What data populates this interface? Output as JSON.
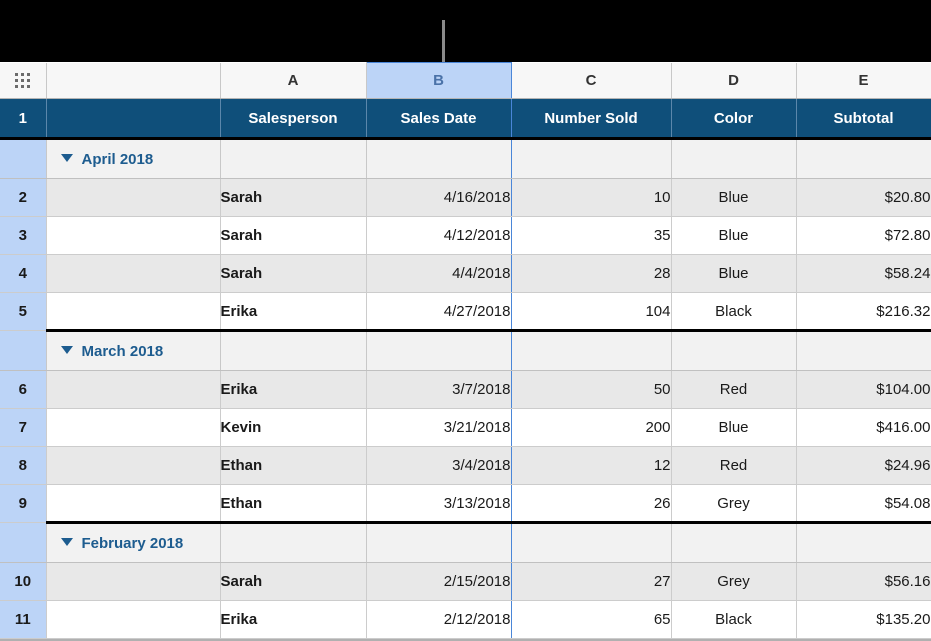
{
  "app": {
    "corner_icon": "grid-handle-icon",
    "selected_column": "B"
  },
  "column_letters": [
    "",
    "A",
    "B",
    "C",
    "D",
    "E"
  ],
  "header_row": {
    "row_number": "1",
    "cells": [
      "",
      "Salesperson",
      "Sales Date",
      "Number Sold",
      "Color",
      "Subtotal"
    ]
  },
  "colors": {
    "header_blue": "#0f4f7a",
    "selection_blue": "#4a86d8",
    "rownum_blue": "#bcd4f7",
    "category_text": "#1d5c8f",
    "alt_row": "#e8e8e8"
  },
  "groups": [
    {
      "label": "April 2018",
      "disclosure": "triangle-down-icon",
      "rows": [
        {
          "num": "2",
          "salesperson": "Sarah",
          "sales_date": "4/16/2018",
          "number_sold": "10",
          "color": "Blue",
          "subtotal": "$20.80"
        },
        {
          "num": "3",
          "salesperson": "Sarah",
          "sales_date": "4/12/2018",
          "number_sold": "35",
          "color": "Blue",
          "subtotal": "$72.80"
        },
        {
          "num": "4",
          "salesperson": "Sarah",
          "sales_date": "4/4/2018",
          "number_sold": "28",
          "color": "Blue",
          "subtotal": "$58.24"
        },
        {
          "num": "5",
          "salesperson": "Erika",
          "sales_date": "4/27/2018",
          "number_sold": "104",
          "color": "Black",
          "subtotal": "$216.32"
        }
      ]
    },
    {
      "label": "March 2018",
      "disclosure": "triangle-down-icon",
      "rows": [
        {
          "num": "6",
          "salesperson": "Erika",
          "sales_date": "3/7/2018",
          "number_sold": "50",
          "color": "Red",
          "subtotal": "$104.00"
        },
        {
          "num": "7",
          "salesperson": "Kevin",
          "sales_date": "3/21/2018",
          "number_sold": "200",
          "color": "Blue",
          "subtotal": "$416.00"
        },
        {
          "num": "8",
          "salesperson": "Ethan",
          "sales_date": "3/4/2018",
          "number_sold": "12",
          "color": "Red",
          "subtotal": "$24.96"
        },
        {
          "num": "9",
          "salesperson": "Ethan",
          "sales_date": "3/13/2018",
          "number_sold": "26",
          "color": "Grey",
          "subtotal": "$54.08"
        }
      ]
    },
    {
      "label": "February 2018",
      "disclosure": "triangle-down-icon",
      "rows": [
        {
          "num": "10",
          "salesperson": "Sarah",
          "sales_date": "2/15/2018",
          "number_sold": "27",
          "color": "Grey",
          "subtotal": "$56.16"
        },
        {
          "num": "11",
          "salesperson": "Erika",
          "sales_date": "2/12/2018",
          "number_sold": "65",
          "color": "Black",
          "subtotal": "$135.20"
        }
      ]
    }
  ]
}
